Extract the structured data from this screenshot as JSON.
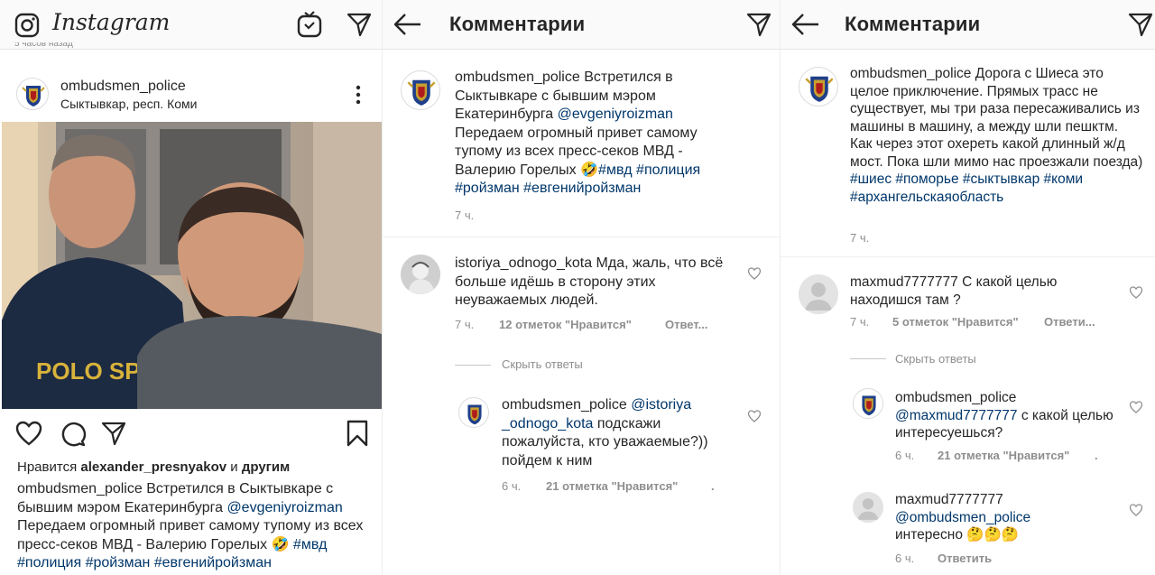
{
  "feed": {
    "app_name": "Instagram",
    "older_time": "5 часов назад",
    "post": {
      "username": "ombudsmen_police",
      "location": "Сыктывкар, респ. Коми",
      "likes_prefix": "Нравится ",
      "likes_user": "alexander_presnyakov",
      "likes_and": " и ",
      "likes_others": "другим",
      "caption_user": "ombudsmen_police",
      "caption_text1": " Встретился в Сыктывкаре с бывшим мэром Екатеринбурга ",
      "caption_mention": "@evgeniyroizman",
      "caption_text2": " Передаем огромный привет самому тупому из всех пресс-секов МВД - Валерию Горелых 🤣",
      "caption_tags": "#мвд #полиция #ройзман #евгенийройзман",
      "photo_text": "POLO SPORT"
    }
  },
  "comments1": {
    "title": "Комментарии",
    "caption": {
      "user": "ombudsmen_police",
      "text1": " Встретился в Сыктывкаре с бывшим мэром Екатеринбурга ",
      "mention": "@evgeniyroizman",
      "text2": " Передаем огромный привет самому тупому из всех пресс-секов МВД - Валерию Горелых 🤣",
      "tags": "#мвд #полиция #ройзман #евгенийройзман",
      "time": "7 ч."
    },
    "comment": {
      "user": "istoriya_odnogo_kota",
      "text": " Мда, жаль, что всё больше идёшь в сторону этих неуважаемых людей.",
      "time": "7 ч.",
      "likes": "12 отметок \"Нравится\"",
      "reply": "Ответ..."
    },
    "hide_replies": "Скрыть ответы",
    "reply": {
      "user": "ombudsmen_police",
      "mention": " @istoriya _odnogo_kota",
      "text": " подскажи пожалуйста, кто уважаемые?)) пойдем к ним",
      "time": "6 ч.",
      "likes": "21 отметка \"Нравится\"",
      "reply": "."
    }
  },
  "comments2": {
    "title": "Комментарии",
    "caption": {
      "user": "ombudsmen_police",
      "text": " Дорога с Шиеса это целое приключение. Прямых трасс не существует, мы три раза пересаживались из машины в машину, а между шли пешктм. Как через этот охереть какой длинный ж/д мост. Пока шли мимо нас проезжали поезда)",
      "tags": "#шиес #поморье #сыктывкар #коми #архангельскаяобласть",
      "time": "7 ч."
    },
    "comment": {
      "user": "maxmud7777777",
      "text": " С какой целью находишся там ?",
      "time": "7 ч.",
      "likes": "5 отметок \"Нравится\"",
      "reply": "Ответи..."
    },
    "hide_replies": "Скрыть ответы",
    "reply1": {
      "user": "ombudsmen_police",
      "mention": "@maxmud7777777",
      "text": " с какой целью интересуешься?",
      "time": "6 ч.",
      "likes": "21 отметка \"Нравится\"",
      "reply": "."
    },
    "reply2": {
      "user": "maxmud7777777",
      "mention": "@ombudsmen_police",
      "text": "интересно 🤔🤔🤔",
      "time": "6 ч.",
      "reply": "Ответить"
    }
  }
}
